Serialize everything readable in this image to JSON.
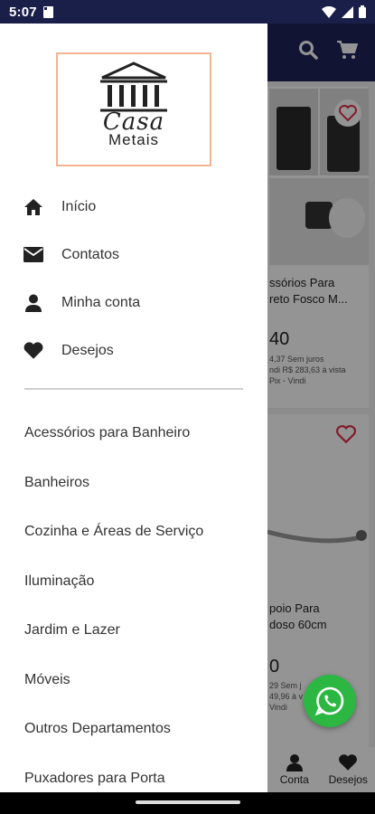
{
  "status_bar": {
    "time": "5:07"
  },
  "app_header": {
    "search_icon": "search-icon",
    "cart_icon": "cart-icon"
  },
  "products": [
    {
      "title_line1": "ssórios Para",
      "title_line2": "reto Fosco M...",
      "price": "40",
      "installment": "4,37 Sem juros",
      "cash": "ndi R$ 283,63 à vista",
      "method": "Pix - Vindi"
    },
    {
      "title_line1": "poio Para",
      "title_line2": "doso 60cm",
      "price": "0",
      "installment": "29 Sem j",
      "cash": "49,96 à v",
      "method": "Vindi"
    }
  ],
  "bottom_nav": {
    "conta": "Conta",
    "desejos": "Desejos"
  },
  "drawer": {
    "logo": {
      "line1": "Casa",
      "line2": "Metais"
    },
    "menu": [
      {
        "label": "Início",
        "icon": "home-icon"
      },
      {
        "label": "Contatos",
        "icon": "envelope-icon"
      },
      {
        "label": "Minha conta",
        "icon": "user-icon"
      },
      {
        "label": "Desejos",
        "icon": "heart-icon"
      }
    ],
    "categories": [
      "Acessórios para Banheiro",
      "Banheiros",
      "Cozinha e Áreas de Serviço",
      "Iluminação",
      "Jardim e Lazer",
      "Móveis",
      "Outros Departamentos",
      "Puxadores para Porta"
    ]
  },
  "colors": {
    "header": "#1e2456",
    "status": "#1a1f4a",
    "accent_heart": "#e0304a",
    "whatsapp": "#2bb741",
    "logo_border": "#f3b38f"
  }
}
